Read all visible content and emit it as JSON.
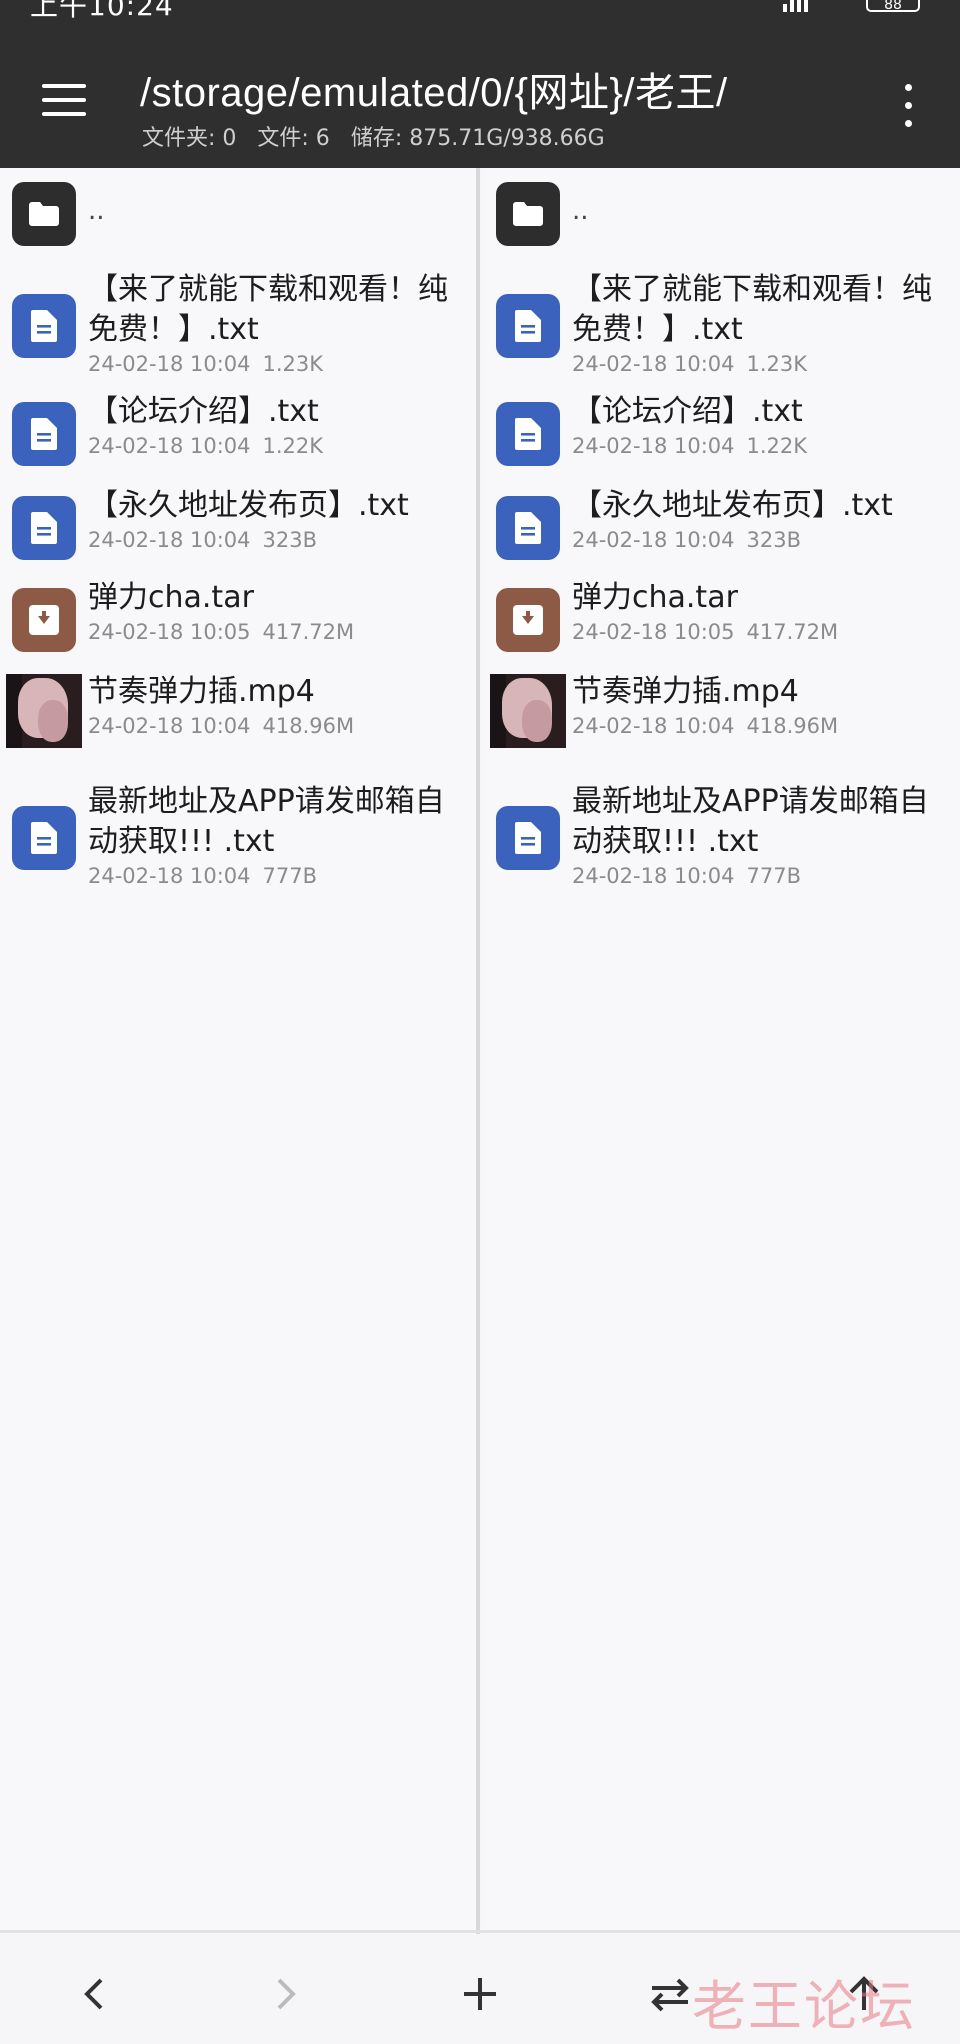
{
  "status_bar": {
    "time": "上午10:24",
    "battery": "88"
  },
  "app_bar": {
    "path": "/storage/emulated/0/{网址}/老王/",
    "info": [
      "文件夹: 0",
      "文件: 6",
      "储存: 875.71G/938.66G"
    ]
  },
  "panes": {
    "left": {
      "parent_label": "..",
      "files": [
        {
          "name": "【来了就能下载和观看！纯免费！】.txt",
          "date": "24-02-18 10:04",
          "size": "1.23K",
          "icon": "document-icon"
        },
        {
          "name": "【论坛介绍】.txt",
          "date": "24-02-18 10:04",
          "size": "1.22K",
          "icon": "document-icon"
        },
        {
          "name": "【永久地址发布页】.txt",
          "date": "24-02-18 10:04",
          "size": "323B",
          "icon": "document-icon"
        },
        {
          "name": "弹力cha.tar",
          "date": "24-02-18 10:05",
          "size": "417.72M",
          "icon": "archive-icon"
        },
        {
          "name": "节奏弹力插.mp4",
          "date": "24-02-18 10:04",
          "size": "418.96M",
          "icon": "video-thumbnail"
        },
        {
          "name": "最新地址及APP请发邮箱自动获取!!! .txt",
          "date": "24-02-18 10:04",
          "size": "777B",
          "icon": "document-icon"
        }
      ]
    },
    "right": {
      "parent_label": "..",
      "files": [
        {
          "name": "【来了就能下载和观看！纯免费！】.txt",
          "date": "24-02-18 10:04",
          "size": "1.23K",
          "icon": "document-icon"
        },
        {
          "name": "【论坛介绍】.txt",
          "date": "24-02-18 10:04",
          "size": "1.22K",
          "icon": "document-icon"
        },
        {
          "name": "【永久地址发布页】.txt",
          "date": "24-02-18 10:04",
          "size": "323B",
          "icon": "document-icon"
        },
        {
          "name": "弹力cha.tar",
          "date": "24-02-18 10:05",
          "size": "417.72M",
          "icon": "archive-icon"
        },
        {
          "name": "节奏弹力插.mp4",
          "date": "24-02-18 10:04",
          "size": "418.96M",
          "icon": "video-thumbnail"
        },
        {
          "name": "最新地址及APP请发邮箱自动获取!!! .txt",
          "date": "24-02-18 10:04",
          "size": "777B",
          "icon": "document-icon"
        }
      ]
    }
  },
  "bottom_bar": {
    "buttons": [
      "back-arrow-icon",
      "forward-arrow-icon",
      "add-icon",
      "swap-icon",
      "up-arrow-icon"
    ]
  },
  "watermark": "老王论坛",
  "colors": {
    "app_bar": "#2f2f2f",
    "doc_icon": "#3b63bd",
    "archive_icon": "#8c5a45",
    "folder_icon": "#2d2d2d"
  }
}
